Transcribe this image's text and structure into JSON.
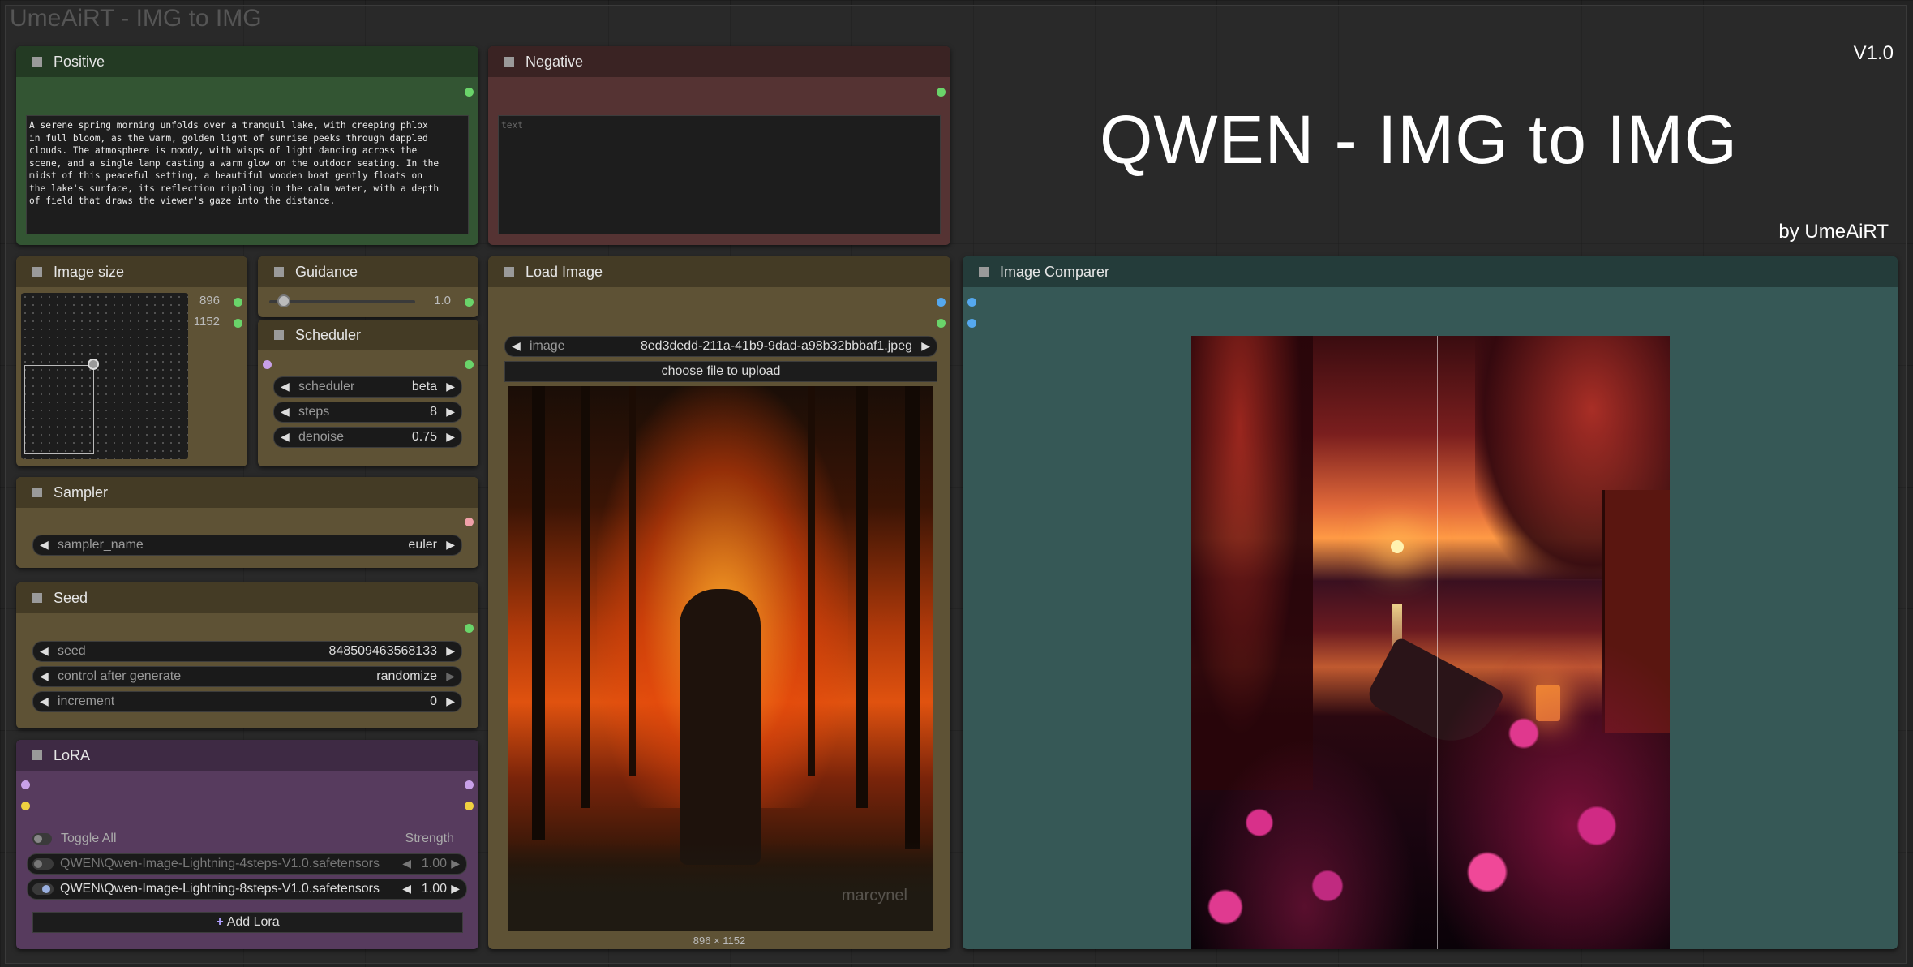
{
  "app": {
    "title": "UmeAiRT - IMG to IMG"
  },
  "banner": {
    "version": "V1.0",
    "title": "QWEN - IMG to IMG",
    "byline": "by UmeAiRT"
  },
  "nodes": {
    "positive": {
      "title": "Positive",
      "lines": [
        "A serene spring morning unfolds over a tranquil lake, with creeping phlox",
        "in full bloom, as the warm, golden light of sunrise peeks through dappled",
        "clouds. The atmosphere is moody, with wisps of light dancing across the",
        "scene, and a single lamp casting a warm glow on the outdoor seating. In the",
        "midst of this peaceful setting, a beautiful wooden boat gently floats on",
        "the lake's surface, its reflection rippling in the calm water, with a depth",
        "of field that draws the viewer's gaze into the distance."
      ]
    },
    "negative": {
      "title": "Negative",
      "placeholder": "text"
    },
    "image_size": {
      "title": "Image size",
      "width": "896",
      "height": "1152"
    },
    "guidance": {
      "title": "Guidance",
      "value": "1.0",
      "fraction": 0.1
    },
    "scheduler": {
      "title": "Scheduler",
      "widgets": [
        {
          "label": "scheduler",
          "value": "beta"
        },
        {
          "label": "steps",
          "value": "8"
        },
        {
          "label": "denoise",
          "value": "0.75"
        }
      ]
    },
    "sampler": {
      "title": "Sampler",
      "label": "sampler_name",
      "value": "euler"
    },
    "seed": {
      "title": "Seed",
      "widgets": [
        {
          "label": "seed",
          "value": "848509463568133"
        },
        {
          "label": "control after generate",
          "value": "randomize"
        },
        {
          "label": "increment",
          "value": "0"
        }
      ]
    },
    "lora": {
      "title": "LoRA",
      "toggle_all": "Toggle All",
      "strength_label": "Strength",
      "items": [
        {
          "name": "QWEN\\Qwen-Image-Lightning-4steps-V1.0.safetensors",
          "strength": "1.00",
          "enabled": false
        },
        {
          "name": "QWEN\\Qwen-Image-Lightning-8steps-V1.0.safetensors",
          "strength": "1.00",
          "enabled": true
        }
      ],
      "add_label": "Add Lora",
      "add_icon": "plus-icon"
    },
    "load_image": {
      "title": "Load Image",
      "image_label": "image",
      "image_value": "8ed3dedd-211a-41b9-9dad-a98b32bbbaf1.jpeg",
      "upload_label": "choose file to upload",
      "dimensions": "896 × 1152",
      "watermark": "marcynel"
    },
    "image_comparer": {
      "title": "Image Comparer"
    }
  }
}
